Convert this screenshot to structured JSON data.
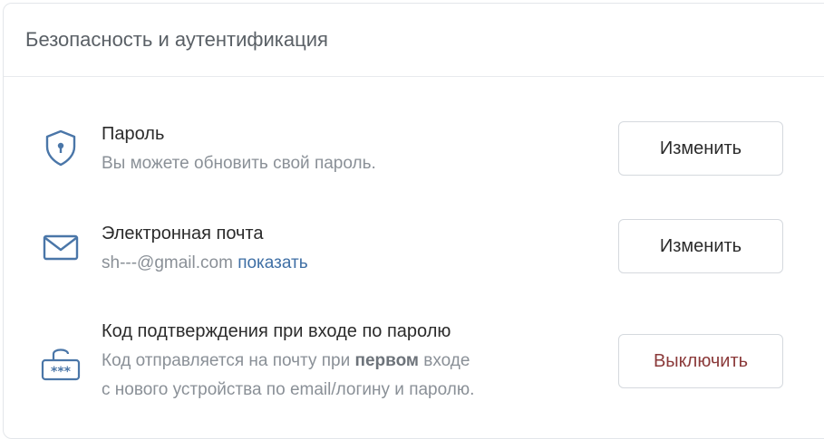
{
  "panel": {
    "title": "Безопасность и аутентификация"
  },
  "password": {
    "icon": "shield-lock-icon",
    "title": "Пароль",
    "description": "Вы можете обновить свой пароль.",
    "button_label": "Изменить"
  },
  "email": {
    "icon": "envelope-icon",
    "title": "Электронная почта",
    "masked_value": "sh---@gmail.com",
    "show_link": "показать",
    "button_label": "Изменить"
  },
  "code": {
    "icon": "padlock-password-icon",
    "title": "Код подтверждения при входе по паролю",
    "desc_before": "Код отправляется на почту при ",
    "desc_bold": "первом",
    "desc_after": " входе",
    "desc_line2": "с нового устройства по email/логину и паролю.",
    "button_label": "Выключить"
  },
  "colors": {
    "icon": "#4a76a8",
    "link": "#3f6fa5",
    "danger": "#8b3a3a"
  }
}
